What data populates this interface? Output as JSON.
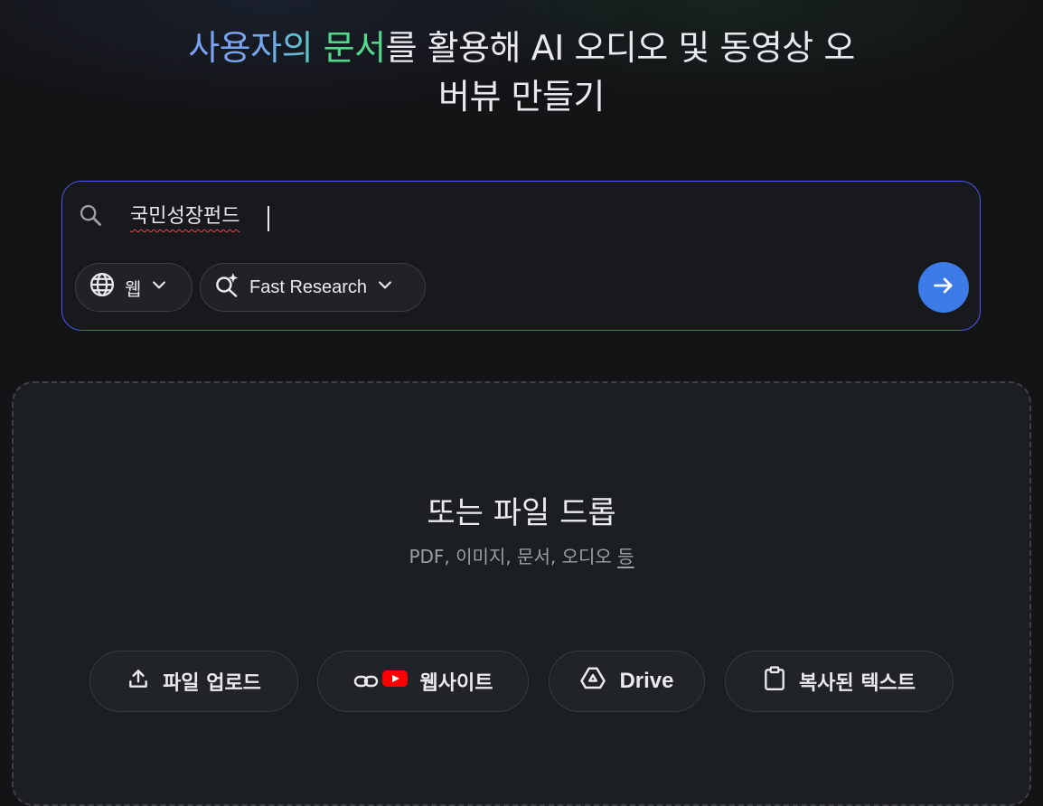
{
  "headline": {
    "part_blue": "사용자의",
    "space": " ",
    "part_green": "문서",
    "line1_rest": "를 활용해 AI 오디오 및 동영상 오",
    "line2": "버뷰 만들기"
  },
  "search": {
    "value": "국민성장펀드",
    "web_chip_label": "웹",
    "research_chip_label": "Fast Research",
    "icons": [
      "search-icon",
      "globe-icon",
      "chevron-down-icon",
      "sparkle-search-icon",
      "arrow-right-icon"
    ]
  },
  "drop": {
    "title": "또는 파일 드롭",
    "subtitle_main": "PDF, 이미지, 문서, 오디오 ",
    "subtitle_more": "등"
  },
  "sources": {
    "upload_label": "파일 업로드",
    "website_label": "웹사이트",
    "drive_label": "Drive",
    "paste_label": "복사된 텍스트"
  },
  "colors": {
    "accent_blue": "#3d7ce8",
    "search_border": "#4a5cf0",
    "headline_green": "#53d98b",
    "youtube_red": "#ff0000"
  }
}
